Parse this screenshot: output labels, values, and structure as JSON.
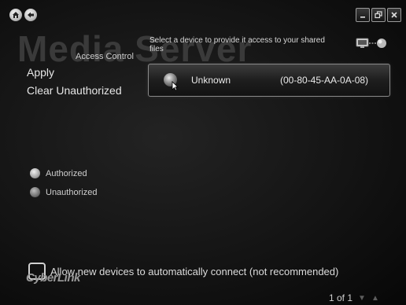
{
  "window": {
    "title_watermark": "Media Server",
    "home_icon": "home-icon",
    "back_icon": "back-arrow-icon",
    "minimize_icon": "minimize-icon",
    "restore_icon": "restore-icon",
    "close_icon": "close-icon"
  },
  "sidebar": {
    "section_label": "Access Control",
    "items": [
      {
        "label": "Apply"
      },
      {
        "label": "Clear Unauthorized"
      }
    ],
    "legend": [
      {
        "label": "Authorized",
        "icon": "authorized-dot-icon"
      },
      {
        "label": "Unauthorized",
        "icon": "unauthorized-dot-icon"
      }
    ]
  },
  "main": {
    "instruction": "Select a device to provide it access to your shared files",
    "network_icon": "network-devices-icon",
    "devices": [
      {
        "name": "Unknown",
        "mac": "(00-80-45-AA-0A-08)",
        "status": "Unauthorized"
      }
    ]
  },
  "footer": {
    "allow_label": "Allow new devices to automatically connect (not recommended)",
    "allow_checked": false,
    "logo": "CyberLink",
    "pager": "1 of 1"
  },
  "colors": {
    "background": "#141414",
    "text": "#dddddd",
    "watermark": "#3a3a3a"
  }
}
